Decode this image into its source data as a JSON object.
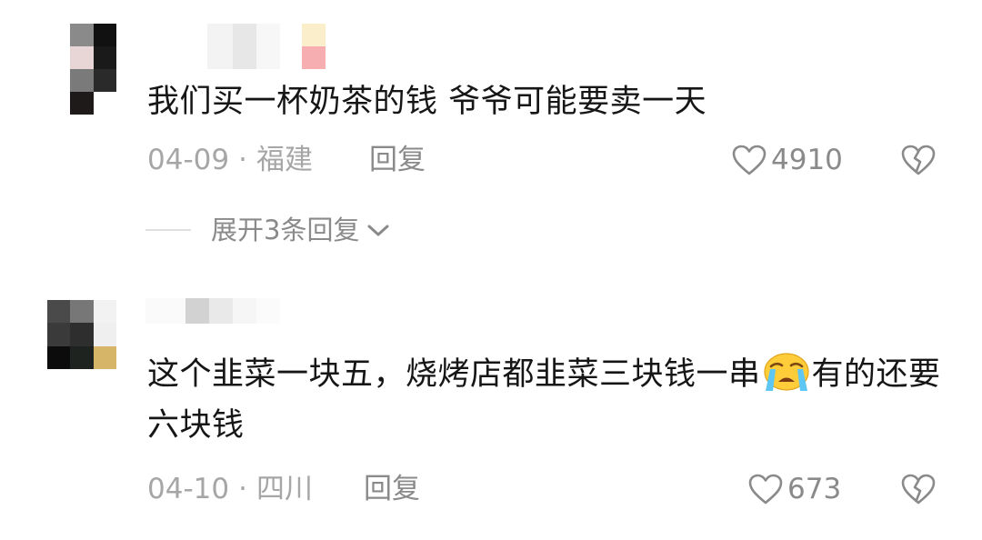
{
  "comments": [
    {
      "text": "我们买一杯奶茶的钱 爷爷可能要卖一天",
      "date": "04-09",
      "location": "福建",
      "reply_label": "回复",
      "likes": "4910",
      "expand_label": "展开3条回复"
    },
    {
      "text_before_emoji": "这个韭菜一块五，烧烤店都韭菜三块钱一串",
      "text_after_emoji": "有的还要六块钱",
      "emoji": "loudly-crying-face",
      "date": "04-10",
      "location": "四川",
      "reply_label": "回复",
      "likes": "673"
    }
  ],
  "separator": "·",
  "icons": {
    "like": "heart-outline-icon",
    "dislike": "broken-heart-icon",
    "expand": "chevron-down-icon"
  },
  "colors": {
    "text_primary": "#161616",
    "text_secondary": "#a6a6a6",
    "action": "#8a8a8a"
  }
}
